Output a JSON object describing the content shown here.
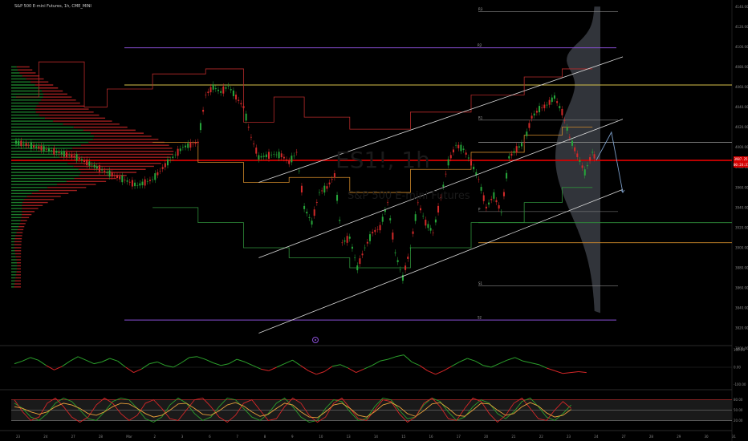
{
  "header": {
    "title": "S&P 500 E-mini Futures, 1h, CME_MINI",
    "watermark_symbol": "ES1!, 1h",
    "watermark_name": "S&P 500 E-mini Futures"
  },
  "colors": {
    "background": "#000000",
    "candle_up": "#26a63a",
    "candle_down": "#d42a2a",
    "channel": "#d9d9d9",
    "pivot_purple": "#8a4fd6",
    "pivot_yellow": "#d8c24a",
    "last_price": "#d40000",
    "volume_profile": "#3a3d44",
    "stair_red": "#b52a2a",
    "stair_orange": "#d18a2a",
    "stair_green": "#2f8f3a",
    "osc_green": "#2ca02c",
    "osc_red": "#d62728",
    "osc_orange": "#e8a13a"
  },
  "last_price": {
    "value": 3987.25,
    "label_line1": "3987.25",
    "label_line2": "00:24:31"
  },
  "chart_data": [
    {
      "type": "line",
      "role": "main-price",
      "ylim": [
        3805,
        4145
      ],
      "price_axis_ticks": [
        4140,
        4120,
        4100,
        4080,
        4060,
        4040,
        4020,
        4000,
        3980,
        3960,
        3940,
        3920,
        3900,
        3880,
        3860,
        3840,
        3820,
        3800
      ],
      "time_axis_labels": [
        "23",
        "24",
        "27",
        "28",
        "Mar",
        "2",
        "3",
        "6",
        "7",
        "8",
        "9",
        "10",
        "13",
        "14",
        "15",
        "16",
        "17",
        "20",
        "21",
        "22",
        "23",
        "24",
        "27",
        "28",
        "29",
        "30",
        "31"
      ],
      "price_path": [
        [
          0,
          4005
        ],
        [
          4,
          3998
        ],
        [
          8,
          3990
        ],
        [
          12,
          3975
        ],
        [
          16,
          3962
        ],
        [
          18,
          3968
        ],
        [
          20,
          3985
        ],
        [
          22,
          4000
        ],
        [
          24,
          4005
        ],
        [
          25,
          4052
        ],
        [
          26,
          4060
        ],
        [
          27,
          4055
        ],
        [
          28,
          4061
        ],
        [
          29,
          4050
        ],
        [
          30,
          4040
        ],
        [
          31,
          4010
        ],
        [
          32,
          3990
        ],
        [
          34,
          3993
        ],
        [
          35,
          3992
        ],
        [
          36,
          3985
        ],
        [
          37,
          3995
        ],
        [
          38,
          3940
        ],
        [
          39,
          3925
        ],
        [
          40,
          3955
        ],
        [
          41,
          3960
        ],
        [
          42,
          3972
        ],
        [
          43,
          3905
        ],
        [
          44,
          3910
        ],
        [
          45,
          3880
        ],
        [
          46,
          3900
        ],
        [
          47,
          3915
        ],
        [
          48,
          3920
        ],
        [
          49,
          3945
        ],
        [
          50,
          3895
        ],
        [
          51,
          3870
        ],
        [
          52,
          3900
        ],
        [
          53,
          3945
        ],
        [
          54,
          3925
        ],
        [
          55,
          3915
        ],
        [
          56,
          3950
        ],
        [
          57,
          3985
        ],
        [
          58,
          4002
        ],
        [
          59,
          3998
        ],
        [
          60,
          3985
        ],
        [
          61,
          3968
        ],
        [
          62,
          3940
        ],
        [
          63,
          3952
        ],
        [
          64,
          3935
        ],
        [
          65,
          3990
        ],
        [
          66,
          3998
        ],
        [
          67,
          4005
        ],
        [
          68,
          4030
        ],
        [
          69,
          4038
        ],
        [
          70,
          4042
        ],
        [
          71,
          4050
        ],
        [
          72,
          4035
        ],
        [
          73,
          4010
        ],
        [
          74,
          3992
        ],
        [
          75,
          3975
        ],
        [
          76,
          3995
        ],
        [
          76.5,
          3987
        ]
      ],
      "projection_path": [
        [
          76.5,
          3987
        ],
        [
          78.5,
          4015
        ],
        [
          80,
          3955
        ]
      ],
      "pivot_levels": [
        {
          "name": "R3",
          "label": "R3",
          "value": 4135
        },
        {
          "name": "R2",
          "label": "R2",
          "value": 4099
        },
        {
          "name": "R1",
          "label": "R1",
          "value": 4027
        },
        {
          "name": "P",
          "label": "P",
          "value": 3936
        },
        {
          "name": "S1",
          "label": "S1",
          "value": 3862
        },
        {
          "name": "S2",
          "label": "S2",
          "value": 3828
        }
      ],
      "horizontal_levels": [
        {
          "name": "upper",
          "value": 4062
        },
        {
          "name": "mid-high",
          "value": 4005
        },
        {
          "name": "current",
          "value": 3987
        },
        {
          "name": "low-mid",
          "value": 3925
        },
        {
          "name": "low",
          "value": 3905
        }
      ],
      "channel_lines": [
        {
          "name": "upper",
          "from": [
            32,
            3965
          ],
          "to": [
            80,
            4090
          ]
        },
        {
          "name": "middle",
          "from": [
            32,
            3890
          ],
          "to": [
            80,
            4028
          ]
        },
        {
          "name": "lower",
          "from": [
            32,
            3815
          ],
          "to": [
            80,
            3958
          ]
        }
      ],
      "stair_red": [
        [
          0,
          4050
        ],
        [
          3,
          4050
        ],
        [
          3,
          4085
        ],
        [
          9,
          4085
        ],
        [
          9,
          4040
        ],
        [
          12,
          4040
        ],
        [
          12,
          4058
        ],
        [
          18,
          4058
        ],
        [
          18,
          4073
        ],
        [
          25,
          4073
        ],
        [
          25,
          4078
        ],
        [
          30,
          4078
        ],
        [
          30,
          4025
        ],
        [
          34,
          4025
        ],
        [
          34,
          4050
        ],
        [
          38,
          4050
        ],
        [
          38,
          4030
        ],
        [
          44,
          4030
        ],
        [
          44,
          4018
        ],
        [
          52,
          4018
        ],
        [
          52,
          4035
        ],
        [
          60,
          4035
        ],
        [
          60,
          4052
        ],
        [
          67,
          4052
        ],
        [
          67,
          4070
        ],
        [
          72,
          4070
        ],
        [
          72,
          4078
        ],
        [
          76,
          4078
        ]
      ],
      "stair_orange": [
        [
          18,
          4005
        ],
        [
          24,
          4005
        ],
        [
          24,
          3985
        ],
        [
          30,
          3985
        ],
        [
          30,
          3965
        ],
        [
          36,
          3965
        ],
        [
          36,
          3970
        ],
        [
          44,
          3970
        ],
        [
          44,
          3955
        ],
        [
          52,
          3955
        ],
        [
          52,
          3978
        ],
        [
          60,
          3978
        ],
        [
          60,
          3995
        ],
        [
          67,
          3995
        ],
        [
          67,
          4012
        ],
        [
          72,
          4012
        ],
        [
          72,
          4020
        ],
        [
          76,
          4020
        ]
      ],
      "stair_green": [
        [
          18,
          3940
        ],
        [
          24,
          3940
        ],
        [
          24,
          3925
        ],
        [
          30,
          3925
        ],
        [
          30,
          3900
        ],
        [
          36,
          3900
        ],
        [
          36,
          3890
        ],
        [
          44,
          3890
        ],
        [
          44,
          3880
        ],
        [
          52,
          3880
        ],
        [
          52,
          3900
        ],
        [
          60,
          3900
        ],
        [
          60,
          3925
        ],
        [
          67,
          3925
        ],
        [
          67,
          3945
        ],
        [
          72,
          3945
        ],
        [
          72,
          3960
        ],
        [
          76,
          3960
        ]
      ]
    },
    {
      "type": "line",
      "role": "oscillator-1",
      "ylim": [
        -100,
        100
      ],
      "axis_labels": [
        "100.00",
        "0.00",
        "-100.00"
      ],
      "zero_line": 0,
      "values": [
        20,
        35,
        55,
        40,
        10,
        -15,
        5,
        35,
        60,
        40,
        20,
        30,
        50,
        35,
        0,
        -30,
        -10,
        20,
        30,
        10,
        0,
        25,
        55,
        60,
        45,
        25,
        10,
        20,
        45,
        30,
        10,
        -10,
        -20,
        0,
        20,
        40,
        10,
        -20,
        -40,
        -25,
        5,
        15,
        -5,
        -30,
        -10,
        10,
        35,
        45,
        60,
        70,
        30,
        10,
        -20,
        -40,
        -20,
        5,
        30,
        50,
        35,
        10,
        0,
        20,
        40,
        55,
        35,
        25,
        15,
        -5,
        -20,
        -35,
        -30,
        -25,
        -30
      ]
    },
    {
      "type": "line",
      "role": "oscillator-2",
      "ylim": [
        0,
        100
      ],
      "axis_labels": [
        "80.00",
        "50.00",
        "20.00"
      ],
      "reference_lines": [
        80,
        50,
        20
      ],
      "series": [
        {
          "color_key": "osc_green",
          "values": [
            70,
            55,
            30,
            20,
            40,
            70,
            85,
            75,
            50,
            25,
            20,
            45,
            75,
            85,
            80,
            55,
            25,
            15,
            30,
            65,
            85,
            70,
            40,
            20,
            30,
            60,
            85,
            80,
            55,
            30,
            20,
            40,
            70,
            85,
            60,
            30,
            15,
            20,
            55,
            80,
            75,
            45,
            20,
            25,
            60,
            85,
            80,
            50,
            25,
            30,
            65,
            85,
            75,
            45,
            20,
            30,
            60,
            80,
            70,
            40,
            25,
            45,
            75,
            85,
            60,
            30,
            20,
            40,
            65
          ]
        },
        {
          "color_key": "osc_red",
          "values": [
            80,
            45,
            20,
            30,
            70,
            85,
            60,
            30,
            15,
            30,
            65,
            85,
            70,
            40,
            20,
            35,
            70,
            80,
            55,
            25,
            20,
            50,
            80,
            85,
            60,
            30,
            15,
            35,
            70,
            80,
            50,
            20,
            25,
            60,
            85,
            70,
            35,
            15,
            30,
            70,
            85,
            55,
            25,
            20,
            50,
            80,
            75,
            40,
            15,
            30,
            70,
            85,
            60,
            25,
            20,
            55,
            85,
            75,
            40,
            15,
            35,
            70,
            85,
            55,
            25,
            20,
            50,
            75,
            55
          ]
        },
        {
          "color_key": "osc_orange",
          "values": [
            60,
            55,
            45,
            38,
            45,
            60,
            70,
            65,
            55,
            40,
            35,
            45,
            60,
            70,
            68,
            55,
            40,
            30,
            35,
            50,
            68,
            70,
            55,
            38,
            35,
            48,
            65,
            72,
            62,
            45,
            32,
            38,
            55,
            70,
            65,
            45,
            30,
            28,
            45,
            65,
            70,
            55,
            35,
            30,
            45,
            65,
            72,
            60,
            40,
            32,
            48,
            68,
            72,
            55,
            35,
            32,
            50,
            70,
            68,
            50,
            35,
            40,
            60,
            72,
            62,
            42,
            30,
            35,
            52
          ]
        }
      ]
    }
  ]
}
